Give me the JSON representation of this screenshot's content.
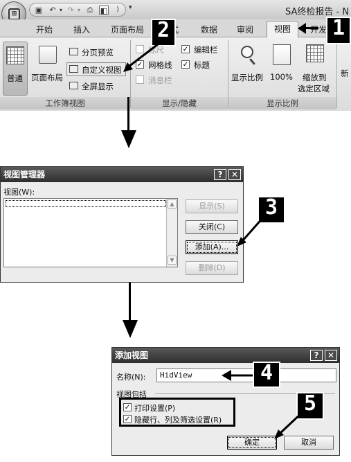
{
  "ribbon": {
    "app_title": "SA终检报告 - N",
    "tabs": [
      "开始",
      "插入",
      "页面布局",
      "式",
      "数据",
      "审阅",
      "视图",
      "开发"
    ],
    "active_tab": "视图",
    "groups": {
      "workbook_views": {
        "label": "工作簿视图",
        "normal": "普通",
        "page_layout": "页面布局",
        "page_break_preview": "分页预览",
        "custom_views": "自定义视图",
        "full_screen": "全屏显示"
      },
      "show_hide": {
        "label": "显示/隐藏",
        "ruler": "标尺",
        "formula_bar": "编辑栏",
        "gridlines": "网格线",
        "headings": "标题",
        "message_bar": "消息栏"
      },
      "zoom": {
        "label": "显示比例",
        "zoom": "显示比例",
        "zoom_100": "100%",
        "zoom_to_selection_line1": "缩放到",
        "zoom_to_selection_line2": "选定区域",
        "new_window_partial": "新"
      }
    }
  },
  "callouts": [
    "1",
    "2",
    "3",
    "4",
    "5"
  ],
  "view_manager": {
    "title": "视图管理器",
    "list_label": "视图(W):",
    "show_button": "显示(S)",
    "close_button": "关闭(C)",
    "add_button": "添加(A)...",
    "delete_button": "删除(D)"
  },
  "add_view": {
    "title": "添加视图",
    "name_label": "名称(N):",
    "name_value": "HidView",
    "include_label": "视图包括",
    "print_settings": "打印设置(P)",
    "hidden_rows": "隐藏行、列及筛选设置(R)",
    "ok_button": "确定",
    "cancel_button": "取消"
  },
  "titlebar_buttons": {
    "help": "?",
    "close": "✕"
  }
}
